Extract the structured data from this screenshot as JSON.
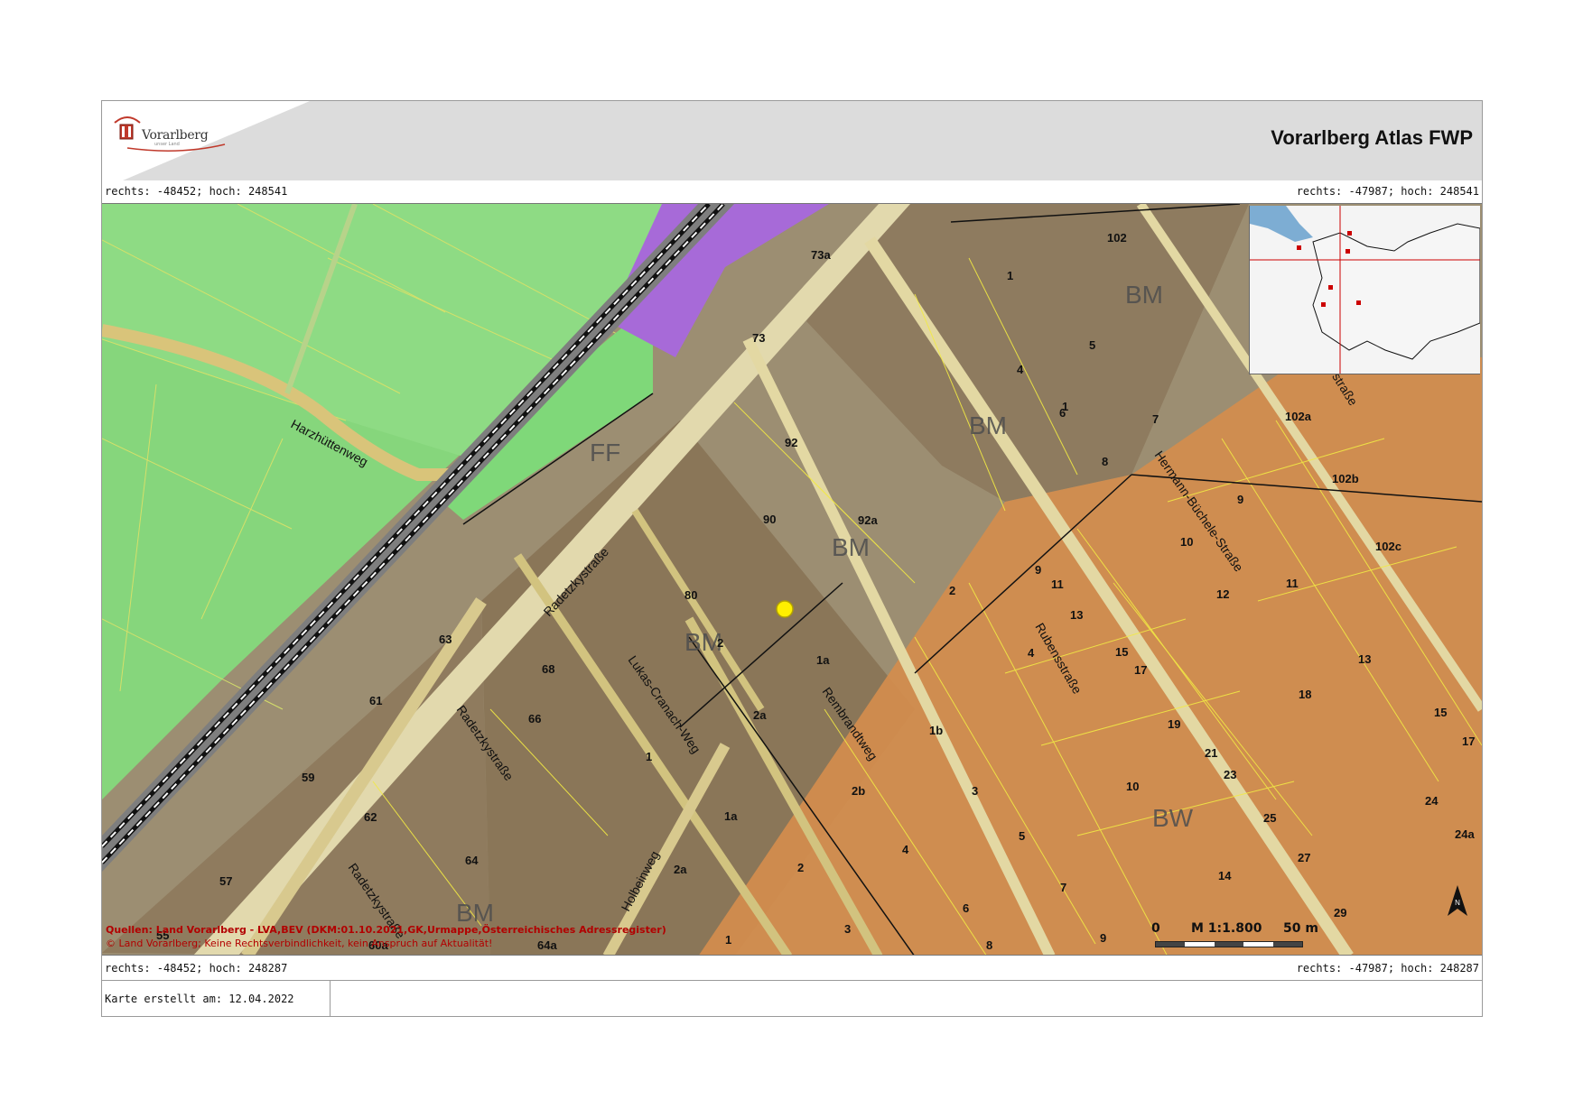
{
  "header": {
    "title": "Vorarlberg Atlas FWP",
    "logo_text": "Vorarlberg",
    "logo_subtext": "unser Land"
  },
  "coords": {
    "top_left": "rechts: -48452; hoch: 248541",
    "top_right": "rechts: -47987; hoch: 248541",
    "bottom_left": "rechts: -48452; hoch: 248287",
    "bottom_right": "rechts: -47987; hoch: 248287"
  },
  "map": {
    "zone_labels": [
      "FF",
      "BM",
      "BM",
      "BM",
      "BM",
      "BM",
      "BW"
    ],
    "street_labels": [
      "Harzhüttenweg",
      "Radetzkystraße",
      "Radetzkystraße",
      "Radetzkystraße",
      "Lukas-Cranach-Weg",
      "Rembrandtweg",
      "Rubensstraße",
      "Hermann-Büchele-Straße",
      "Holbeinweg",
      "ystraße"
    ],
    "house_numbers": [
      "73a",
      "73",
      "92",
      "90",
      "92a",
      "80",
      "2",
      "1a",
      "2a",
      "63",
      "61",
      "68",
      "66",
      "59",
      "62",
      "64",
      "57",
      "55",
      "1",
      "1a",
      "2a",
      "2",
      "3",
      "4",
      "2b",
      "1b",
      "3",
      "5",
      "6",
      "7",
      "8",
      "1",
      "102",
      "1",
      "5",
      "4",
      "6",
      "7",
      "8",
      "9",
      "11",
      "13",
      "4",
      "10",
      "12",
      "15",
      "17",
      "19",
      "21",
      "23",
      "25",
      "27",
      "29",
      "10",
      "14",
      "9",
      "102a",
      "102b",
      "102c",
      "9",
      "11",
      "13",
      "18",
      "15",
      "17",
      "24",
      "24a",
      "2",
      "2b",
      "64a",
      "60a",
      "3",
      "8",
      "9",
      "1"
    ],
    "marker_color": "#ffef00"
  },
  "source": {
    "line1": "Quellen: Land Vorarlberg - LVA,BEV (DKM:01.10.2021,GK,Urmappe,Österreichisches Adressregister)",
    "line2": "© Land Vorarlberg; Keine Rechtsverbindlichkeit, kein Anspruch auf Aktualität!"
  },
  "scale": {
    "start": "0",
    "ratio": "M 1:1.800",
    "end": "50 m"
  },
  "north_label": "N",
  "footer": {
    "created": "Karte erstellt am: 12.04.2022"
  },
  "colors": {
    "green_zone": "#82d67a",
    "purple_zone": "#a368d6",
    "brown_zone": "#8e7a5e",
    "orange_zone": "#d99252",
    "road": "#e4d9a3",
    "railway": "#8a8a8a",
    "header_bg": "#dcdcdc"
  }
}
